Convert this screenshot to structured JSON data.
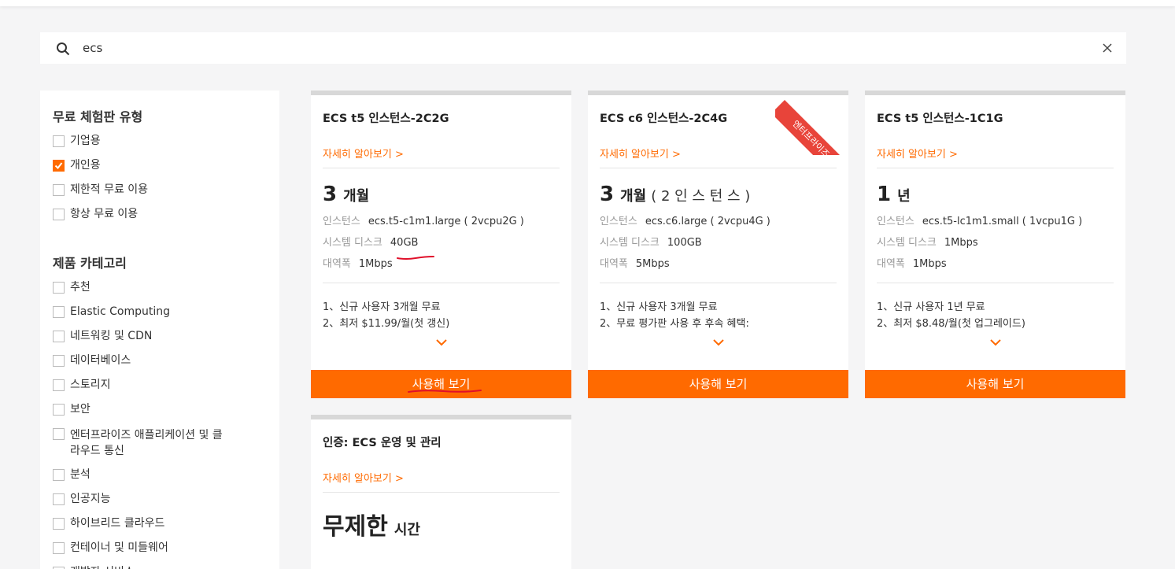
{
  "search": {
    "value": "ecs"
  },
  "sidebar": {
    "groups": [
      {
        "title": "무료 체험판 유형",
        "items": [
          {
            "label": "기업용",
            "checked": false
          },
          {
            "label": "개인용",
            "checked": true
          },
          {
            "label": "제한적 무료 이용",
            "checked": false
          },
          {
            "label": "항상 무료 이용",
            "checked": false
          }
        ]
      },
      {
        "title": "제품 카테고리",
        "items": [
          {
            "label": "추천",
            "checked": false
          },
          {
            "label": "Elastic Computing",
            "checked": false
          },
          {
            "label": "네트워킹 및 CDN",
            "checked": false
          },
          {
            "label": "데이터베이스",
            "checked": false
          },
          {
            "label": "스토리지",
            "checked": false
          },
          {
            "label": "보안",
            "checked": false
          },
          {
            "label": "엔터프라이즈 애플리케이션 및 클라우드 통신",
            "checked": false
          },
          {
            "label": "분석",
            "checked": false
          },
          {
            "label": "인공지능",
            "checked": false
          },
          {
            "label": "하이브리드 클라우드",
            "checked": false
          },
          {
            "label": "컨테이너 및 미들웨어",
            "checked": false
          },
          {
            "label": "개발자 서비스",
            "checked": false
          }
        ]
      }
    ]
  },
  "cards": [
    {
      "title": "ECS t5 인스턴스-2C2G",
      "more": "자세히 알아보기 >",
      "period_num": "3",
      "period_unit": "개월",
      "period_extra": "",
      "specs": [
        {
          "k": "인스턴스",
          "v": "ecs.t5-c1m1.large ( 2vcpu2G )"
        },
        {
          "k": "시스템 디스크",
          "v": "40GB"
        },
        {
          "k": "대역폭",
          "v": "1Mbps"
        }
      ],
      "notes": [
        "1、신규 사용자 3개월 무료",
        "2、최저 $11.99/월(첫 갱신)"
      ],
      "cta": "사용해 보기"
    },
    {
      "title": "ECS c6 인스턴스-2C4G",
      "more": "자세히 알아보기 >",
      "period_num": "3",
      "period_unit": "개월",
      "period_extra": "( 2 인 스 턴 스 )",
      "specs": [
        {
          "k": "인스턴스",
          "v": "ecs.c6.large ( 2vcpu4G )"
        },
        {
          "k": "시스템 디스크",
          "v": "100GB"
        },
        {
          "k": "대역폭",
          "v": "5Mbps"
        }
      ],
      "notes": [
        "1、신규 사용자 3개월 무료",
        "2、무료 평가판 사용 후 후속 혜택:"
      ],
      "cta": "사용해 보기",
      "ribbon": "엔터프라이즈 +"
    },
    {
      "title": "ECS t5 인스턴스-1C1G",
      "more": "자세히 알아보기 >",
      "period_num": "1",
      "period_unit": "년",
      "period_extra": "",
      "specs": [
        {
          "k": "인스턴스",
          "v": "ecs.t5-lc1m1.small ( 1vcpu1G )"
        },
        {
          "k": "시스템 디스크",
          "v": "1Mbps"
        },
        {
          "k": "대역폭",
          "v": "1Mbps"
        }
      ],
      "notes": [
        "1、신규 사용자 1년 무료",
        "2、최저 $8.48/월(첫 업그레이드)"
      ],
      "cta": "사용해 보기"
    },
    {
      "title": "인증: ECS 운영 및 관리",
      "more": "자세히 알아보기 >",
      "period_num": "무제한",
      "period_unit": "시간"
    }
  ],
  "colors": {
    "accent": "#ff6a00",
    "ribbon": "#e8443a",
    "annotation": "#e0102a"
  },
  "icons": {
    "search": "search-icon",
    "clear": "close-icon",
    "expand": "chevron-down-icon",
    "check": "check-icon"
  }
}
